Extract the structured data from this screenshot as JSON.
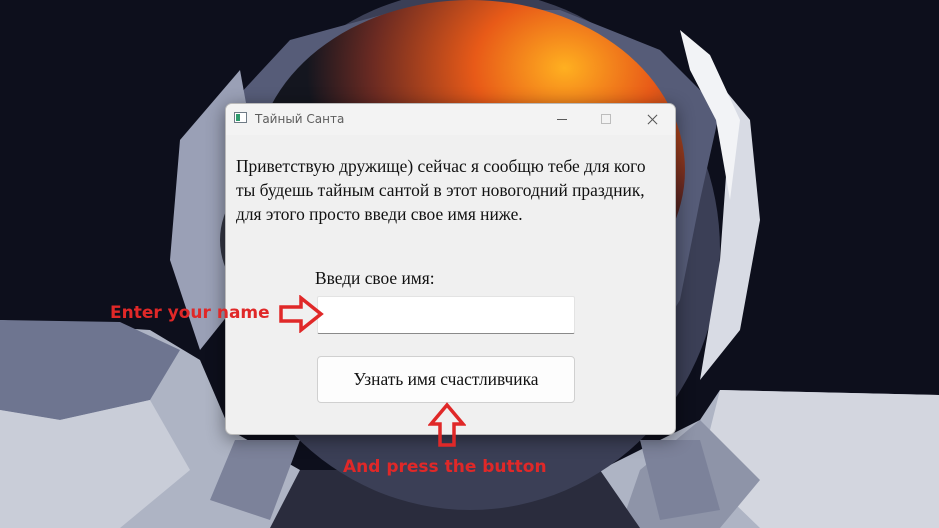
{
  "window": {
    "title": "Тайный Санта",
    "controls": {
      "minimize": "minimize-icon",
      "maximize": "maximize-icon",
      "close": "close-icon"
    }
  },
  "main": {
    "message": "Приветствую дружище) сейчас я сообщю тебе для кого ты будешь тайным сантой в этот новогодний праздник, для этого просто введи свое имя ниже.",
    "name_label": "Введи свое имя:",
    "name_input": {
      "value": "",
      "placeholder": ""
    },
    "submit_label": "Узнать имя счастливчика"
  },
  "annotations": {
    "enter_name": "Enter your name",
    "press_button": "And press the button",
    "color": "#e02828"
  },
  "colors": {
    "desktop_background": "#0d0f1c",
    "dialog_background": "#f0f0f0",
    "annotation": "#e02828"
  }
}
